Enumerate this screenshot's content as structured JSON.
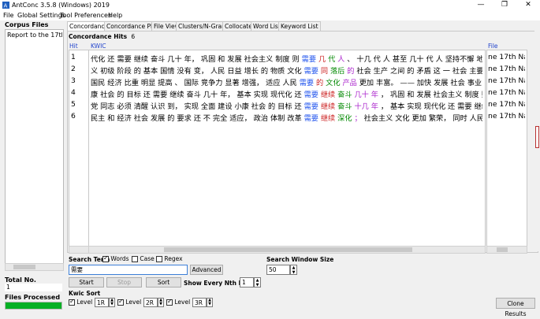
{
  "window": {
    "title": "AntConc 3.5.8 (Windows) 2019"
  },
  "menu": [
    "File",
    "Global Settings",
    "Tool Preferences",
    "Help"
  ],
  "left_panel": {
    "corpus_files_label": "Corpus Files",
    "files": [
      "Report to the 17th N"
    ],
    "total_no_label": "Total No.",
    "total_no_value": "1",
    "files_processed_label": "Files Processed",
    "progress": 1.0
  },
  "tabs": [
    "Concordance",
    "Concordance Plot",
    "File View",
    "Clusters/N-Grams",
    "Collocates",
    "Word List",
    "Keyword List"
  ],
  "concordance": {
    "hits_label": "Concordance Hits",
    "hits_value": "6",
    "col_hit": "Hit",
    "col_kwic": "KWIC",
    "col_file": "File",
    "rows": [
      {
        "hit": "1",
        "left": "代化 还 需要 继续 奋斗 几十 年， 巩固 和 发展 社会主义 制度 则 ",
        "kw": "需要",
        "r1": "几",
        "r2": "代",
        "r3": "人",
        "rest": "、 十几 代 人 甚至 几十 代 人 坚持不懈 地 努力 奋斗",
        "file": "ne 17th Nat"
      },
      {
        "hit": "2",
        "left": "义 初级 阶段 的 基本 国情 没有 变， 人民 日益 增长 的 物质 文化 ",
        "kw": "需要",
        "r1": "同",
        "r2": "落后",
        "r3": "的",
        "rest": "社会 生产 之间 的 矛盾 这 一 社会 主要矛盾 没有",
        "file": "ne 17th Nat"
      },
      {
        "hit": "3",
        "left": "国民 经济 比重 明显 提高 、 国际 竞争力 显著 增强， 适应 人民 ",
        "kw": "需要",
        "r1": "的",
        "r2": "文化",
        "r3": "产品",
        "rest": "更加 丰富。 —— 加快 发展 社会 事业， 全面",
        "file": "ne 17th Nat"
      },
      {
        "hit": "4",
        "left": "康 社会 的 目标 还 需要 继续 奋斗 几十 年， 基本 实现 现代化 还 ",
        "kw": "需要",
        "r1": "继续",
        "r2": "奋斗",
        "r3": "几十 年",
        "rest": "， 巩固 和 发展 社会主义 制度 则 需要 几 代",
        "file": "ne 17th Nat"
      },
      {
        "hit": "5",
        "left": "党 同志 必须 清醒 认识 到， 实现 全面 建设 小康 社会 的 目标 还 ",
        "kw": "需要",
        "r1": "继续",
        "r2": "奋斗",
        "r3": "十几 年",
        "rest": "， 基本 实现 现代化 还 需要 继续 奋斗 几十",
        "file": "ne 17th Nat"
      },
      {
        "hit": "6",
        "left": "民主 和 经济 社会 发展 的 要求 还 不 完全 适应， 政治 体制 改革 ",
        "kw": "需要",
        "r1": "继续",
        "r2": "深化",
        "r3": "；",
        "rest": " 社会主义 文化 更加 繁荣， 同时 人民 精神 文化",
        "file": "ne 17th Nat"
      }
    ]
  },
  "search": {
    "term_label": "Search Term",
    "words_label": "Words",
    "words_checked": true,
    "case_label": "Case",
    "case_checked": false,
    "regex_label": "Regex",
    "regex_checked": false,
    "term_value": "需要",
    "advanced_label": "Advanced",
    "window_label": "Search Window Size",
    "window_value": "50",
    "start_label": "Start",
    "stop_label": "Stop",
    "sort_label": "Sort",
    "nth_label": "Show Every Nth Row",
    "nth_value": "1"
  },
  "kwic_sort": {
    "label": "Kwic Sort",
    "levels": [
      {
        "label": "Level 1",
        "value": "1R",
        "checked": true
      },
      {
        "label": "Level 2",
        "value": "2R",
        "checked": true
      },
      {
        "label": "Level 3",
        "value": "3R",
        "checked": true
      }
    ],
    "clone_label": "Clone Results"
  },
  "colors": {
    "keyword": "#2255ee",
    "r1": "#cc2222",
    "r2": "#008800",
    "r3": "#aa22cc",
    "progress": "#06b025"
  }
}
